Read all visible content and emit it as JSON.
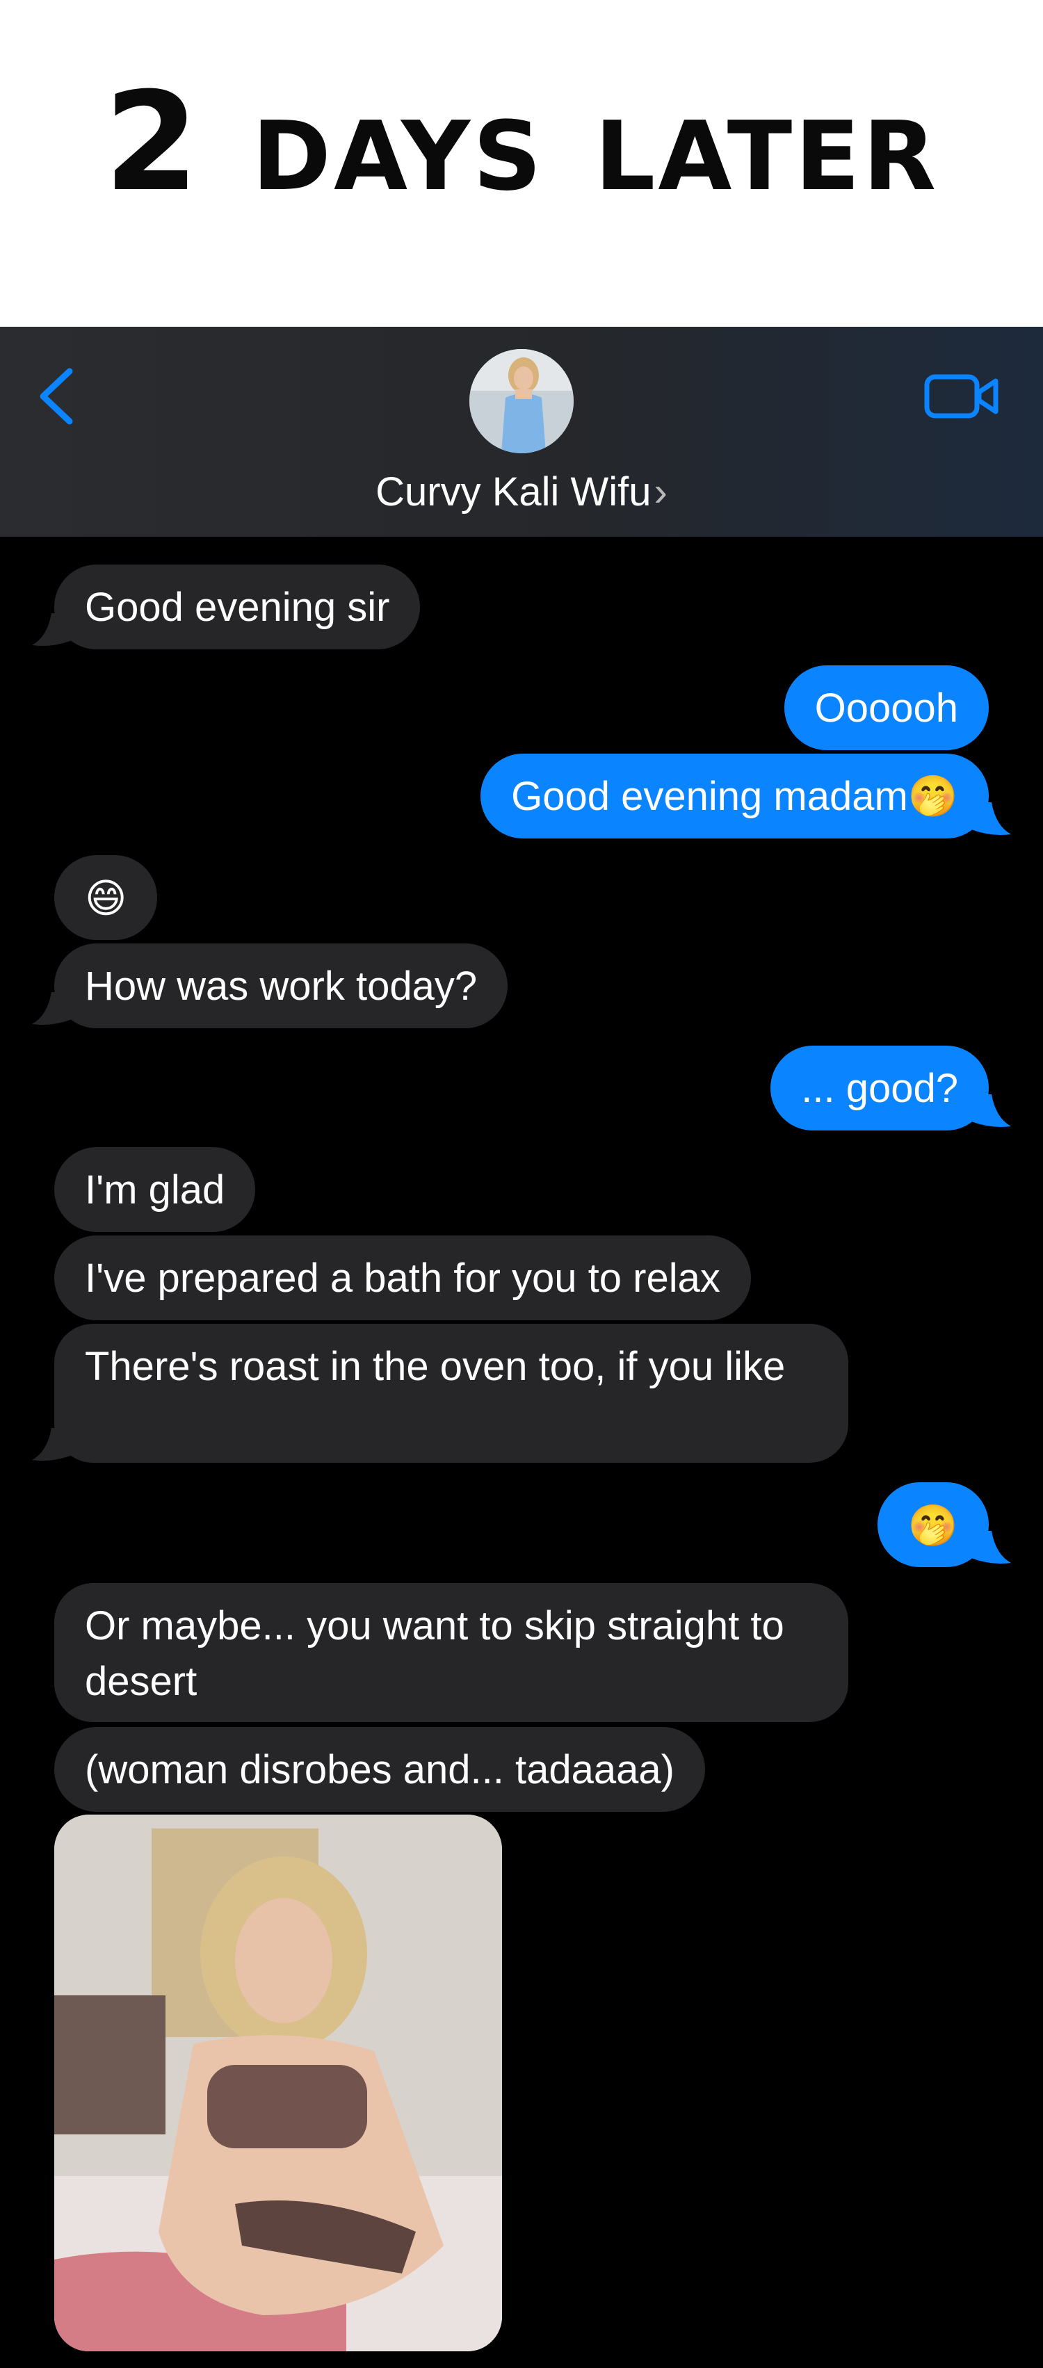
{
  "banner": {
    "title": "2 days later"
  },
  "header": {
    "contact_name": "Curvy Kali Wifu",
    "chevron": "›",
    "back_icon": "chevron-left-icon",
    "video_icon": "video-camera-icon"
  },
  "colors": {
    "accent": "#0a84ff",
    "incoming": "#262628",
    "background": "#000000"
  },
  "messages": [
    {
      "from": "them",
      "text": "Good evening sir"
    },
    {
      "from": "me",
      "text": "Oooooh"
    },
    {
      "from": "me",
      "text": "Good evening madam🤭"
    },
    {
      "from": "them",
      "text": "😄"
    },
    {
      "from": "them",
      "text": "How was work today?"
    },
    {
      "from": "me",
      "text": "... good?"
    },
    {
      "from": "them",
      "text": "I'm glad"
    },
    {
      "from": "them",
      "text": "I've prepared a bath for you to relax"
    },
    {
      "from": "them",
      "text": "There's roast in the oven too, if you like"
    },
    {
      "from": "me",
      "text": "🤭"
    },
    {
      "from": "them",
      "text": "Or maybe... you want to skip straight to desert"
    },
    {
      "from": "them",
      "text": "(woman disrobes and... tadaaaa)"
    },
    {
      "from": "them",
      "type": "image"
    }
  ]
}
